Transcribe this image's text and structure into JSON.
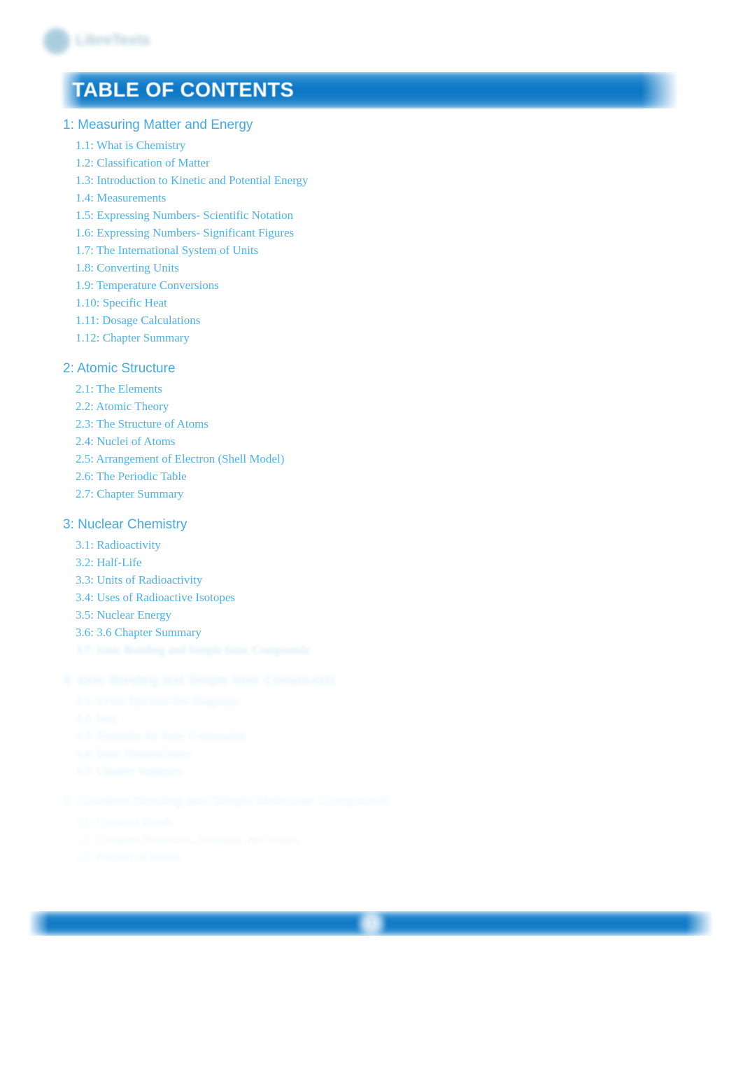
{
  "brand": {
    "logo_icon": "libretexts-circle-logo",
    "wordmark": "LibreTexts"
  },
  "header": {
    "title": "TABLE OF CONTENTS",
    "banner_color": "#0b76c4",
    "title_color": "#ffffff"
  },
  "theme": {
    "chapter_color": "#43a9e8",
    "section_color": "#4bb0ea",
    "footer_color": "#0d77c5"
  },
  "toc": {
    "chapters": [
      {
        "title": "1: Measuring Matter and Energy",
        "visibility": "clear",
        "sections": [
          "1.1: What is Chemistry",
          "1.2: Classification of Matter",
          "1.3: Introduction to Kinetic and Potential Energy",
          "1.4: Measurements",
          "1.5: Expressing Numbers- Scientific Notation",
          "1.6: Expressing Numbers- Significant Figures",
          "1.7: The International System of Units",
          "1.8: Converting Units",
          "1.9: Temperature Conversions",
          "1.10: Specific Heat",
          "1.11: Dosage Calculations",
          "1.12: Chapter Summary"
        ]
      },
      {
        "title": "2: Atomic Structure",
        "visibility": "clear",
        "sections": [
          "2.1: The Elements",
          "2.2: Atomic Theory",
          "2.3: The Structure of Atoms",
          "2.4: Nuclei of Atoms",
          "2.5: Arrangement of Electron (Shell Model)",
          "2.6: The Periodic Table",
          "2.7: Chapter Summary"
        ]
      },
      {
        "title": "3: Nuclear Chemistry",
        "visibility": "clear",
        "sections": [
          "3.1: Radioactivity",
          "3.2: Half-Life",
          "3.3: Units of Radioactivity",
          "3.4: Uses of Radioactive Isotopes",
          "3.5: Nuclear Energy",
          "3.6: 3.6 Chapter Summary"
        ],
        "faded_sections": [
          "3.7: Ionic Bonding and Simple Ionic Compounds"
        ]
      },
      {
        "title": "4: Ionic Bonding and Simple Ionic Compounds",
        "visibility": "faded",
        "sections": [
          "4.1: Lewis Electron Dot Diagrams",
          "4.2: Ions",
          "4.3: Formulas for Ionic Compounds",
          "4.4: Ionic Nomenclature",
          "4.5: Chapter Summary"
        ]
      },
      {
        "title": "5: Covalent Bonding and Simple Molecular Compounds",
        "visibility": "faded",
        "sections": [
          "5.1: Covalent Bonds",
          "5.2: Covalent Molecules, Formulas and Names",
          "5.3: Polarity of Bonds"
        ]
      }
    ]
  },
  "footer": {
    "page_number": "1"
  }
}
